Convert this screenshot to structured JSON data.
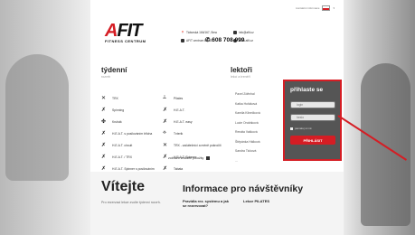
{
  "header": {
    "top_links": "kontaktní informace",
    "logo_main_a": "A",
    "logo_main_rest": "FIT",
    "logo_sub": "FITNESS CENTRUM",
    "address": "Tábor­ská 166/167, Brno",
    "facebook": "AFIT centrum BRNO",
    "email": "info@afit.cz",
    "web": "www.afit.cz",
    "phone": "608 708 099"
  },
  "sections": {
    "lessons_title": "týdenní",
    "lessons_sub": "rozvrh",
    "lecturers_title": "lektoři",
    "lecturers_sub": "lekcí a trenéři"
  },
  "lessons_col1": [
    {
      "label": "TRX",
      "icon": "trx-icon"
    },
    {
      "label": "Spinning",
      "icon": "spinning-icon"
    },
    {
      "label": "Kruhák",
      "icon": "circuit-icon"
    },
    {
      "label": "H.E.A.T. s posilováním břicha",
      "icon": "heat-icon"
    },
    {
      "label": "H.E.A.T. circuit",
      "icon": "heat-icon"
    },
    {
      "label": "H.E.A.T. / TRX",
      "icon": "heat-icon"
    },
    {
      "label": "H.E.A.T. Spinner s posilováním",
      "icon": "heat-icon"
    }
  ],
  "lessons_col2": [
    {
      "label": "Pilates",
      "icon": "pilates-icon"
    },
    {
      "label": "H.E.A.T.",
      "icon": "heat-icon"
    },
    {
      "label": "H.E.A.T. easy",
      "icon": "heat-icon"
    },
    {
      "label": "Tvterik",
      "icon": "stretch-icon"
    },
    {
      "label": "TRX - začátečníci a méně pokročilí",
      "icon": "trx-icon"
    },
    {
      "label": "H.E.A.T. Spinner",
      "icon": "heat-icon"
    },
    {
      "label": "Tabata",
      "icon": "tabata-icon"
    }
  ],
  "lecturers": [
    "Pavel Zděnhal",
    "Katka Hořáková",
    "Kamila Klinečková",
    "Lucie Ondráková",
    "Renáta Vašková",
    "Štěpánka Hálková",
    "Sandra Ticková",
    "..."
  ],
  "all_lessons_link": "zobrazit veškeré položky",
  "login": {
    "title": "přihlaste se",
    "username_placeholder": "login",
    "password_placeholder": "heslo",
    "remember_label": "pamatuj si mě",
    "submit_label": "PŘIHLÁSIT"
  },
  "bottom": {
    "welcome": "Vítejte",
    "welcome_text": "Pro rezervaci lekce zvolte týdenní rozvrh.",
    "info_title": "Informace pro návštěvníky",
    "info_col1": "Pravidla rez. systému a jak se rezervovat?",
    "info_col2": "Lekce PILATES"
  },
  "colors": {
    "accent": "#d51d24",
    "panel": "#555555"
  }
}
